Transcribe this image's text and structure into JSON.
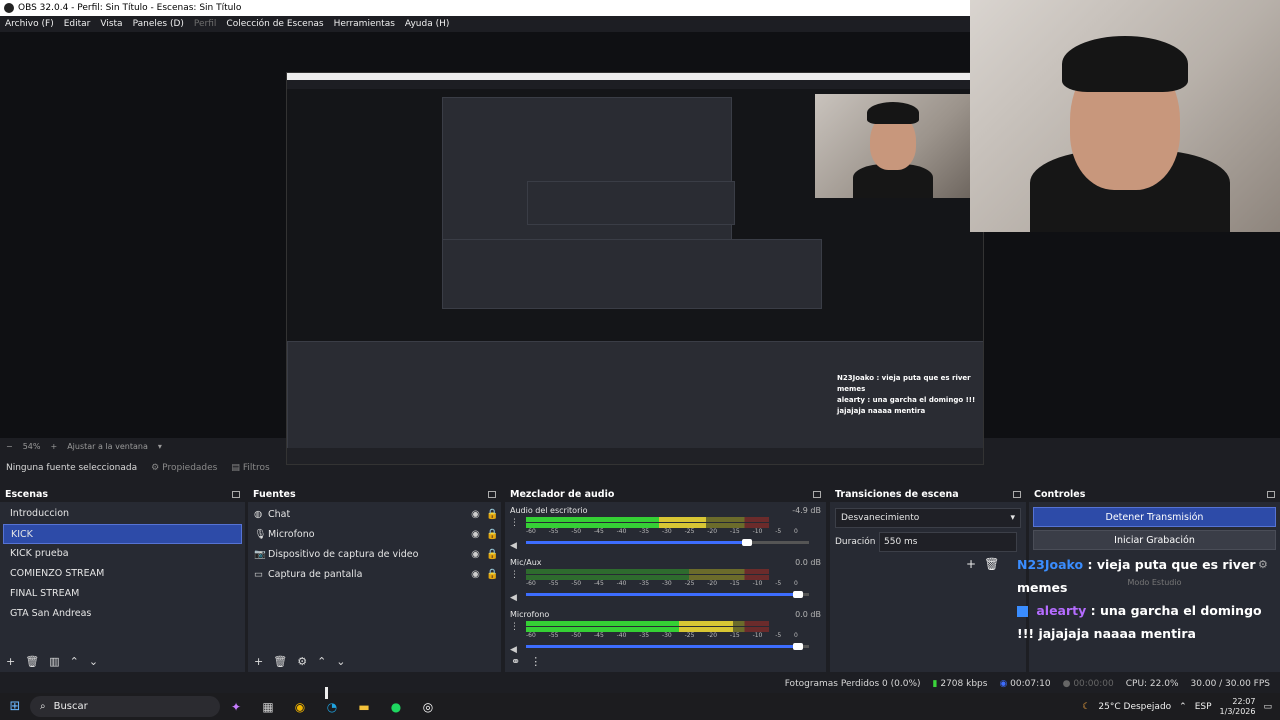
{
  "window": {
    "title": "OBS 32.0.4 - Perfil: Sin Título - Escenas: Sin Título"
  },
  "menu": [
    {
      "label": "Archivo (F)",
      "disabled": false
    },
    {
      "label": "Editar",
      "disabled": false
    },
    {
      "label": "Vista",
      "disabled": false
    },
    {
      "label": "Paneles (D)",
      "disabled": false
    },
    {
      "label": "Perfil",
      "disabled": true
    },
    {
      "label": "Colección de Escenas",
      "disabled": false
    },
    {
      "label": "Herramientas",
      "disabled": false
    },
    {
      "label": "Ayuda (H)",
      "disabled": false
    }
  ],
  "preview_bar": {
    "zoom": "54%",
    "fit": "Ajustar a la ventana"
  },
  "source_toolbar": {
    "status": "Ninguna fuente seleccionada",
    "properties": "Propiedades",
    "filters": "Filtros"
  },
  "scenes": {
    "title": "Escenas",
    "items": [
      "Introduccion",
      "KICK",
      "KICK prueba",
      "COMIENZO STREAM",
      "FINAL STREAM",
      "GTA San Andreas"
    ],
    "selected_index": 1
  },
  "sources": {
    "title": "Fuentes",
    "items": [
      {
        "label": "Chat",
        "icon": "globe-icon"
      },
      {
        "label": "Microfono",
        "icon": "mic-icon"
      },
      {
        "label": "Dispositivo de captura de video",
        "icon": "camera-icon"
      },
      {
        "label": "Captura de pantalla",
        "icon": "monitor-icon"
      }
    ]
  },
  "mixer": {
    "title": "Mezclador de audio",
    "scale": [
      "-60",
      "-55",
      "-50",
      "-45",
      "-40",
      "-35",
      "-30",
      "-25",
      "-20",
      "-15",
      "-10",
      "-5",
      "0"
    ],
    "channels": [
      {
        "name": "Audio del escritorio",
        "db": "-4.9 dB",
        "level": 0.74,
        "volume": 0.78
      },
      {
        "name": "Mic/Aux",
        "db": "0.0 dB",
        "level": 0.0,
        "volume": 0.96
      },
      {
        "name": "Microfono",
        "db": "0.0 dB",
        "level": 0.85,
        "volume": 0.96
      }
    ]
  },
  "transitions": {
    "title": "Transiciones de escena",
    "selected": "Desvanecimiento",
    "duration_label": "Duración",
    "duration_value": "550 ms"
  },
  "controls": {
    "title": "Controles",
    "stop_stream": "Detener Transmisión",
    "start_recording": "Iniciar Grabación",
    "studio_mode": "Modo Estudio"
  },
  "chat_overlay": {
    "messages": [
      {
        "user": "N23Joako",
        "text": ": vieja puta que es river memes"
      },
      {
        "user": "alearty",
        "text": ": una garcha el domingo !!! jajajaja naaaa mentira"
      }
    ]
  },
  "statusbar": {
    "dropped": "Fotogramas Perdidos 0 (0.0%)",
    "bitrate": "2708 kbps",
    "stream_time": "00:07:10",
    "rec_time": "00:00:00",
    "cpu": "CPU: 22.0%",
    "fps": "30.00 / 30.00 FPS"
  },
  "taskbar": {
    "search": "Buscar",
    "weather": "25°C  Despejado",
    "lang": "ESP",
    "time": "22:07",
    "date": "1/3/2026"
  },
  "inner_preview": {
    "chat1": "N23Joako : vieja puta que es river memes",
    "chat2": "alearty : una garcha el domingo !!! jajajaja naaaa mentira"
  }
}
